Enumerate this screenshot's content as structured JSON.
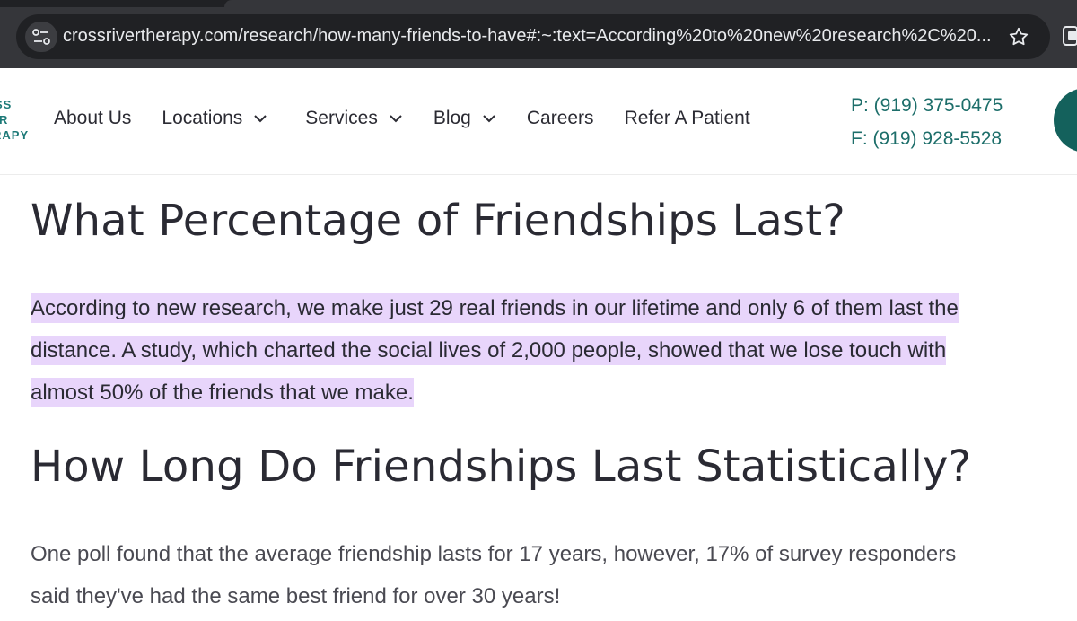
{
  "browser": {
    "url": "crossrivertherapy.com/research/how-many-friends-to-have#:~:text=According%20to%20new%20research%2C%20..."
  },
  "header": {
    "logo_lines": [
      "SS",
      "R",
      "RAPY"
    ],
    "nav": {
      "about": "About Us",
      "locations": "Locations",
      "services": "Services",
      "blog": "Blog",
      "careers": "Careers",
      "refer": "Refer A Patient"
    },
    "phone": "P: (919) 375-0475",
    "fax": "F: (919) 928-5528"
  },
  "article": {
    "heading1": "What Percentage of Friendships Last?",
    "paragraph1_lines": [
      "According to new research, we make just 29 real friends in our lifetime and only 6 of them last the",
      "distance. A study, which charted the social lives of 2,000 people, showed that we lose touch with",
      "almost 50% of the friends that we make."
    ],
    "heading2": "How Long Do Friendships Last Statistically?",
    "paragraph2_lines": [
      "One poll found that the average friendship lasts for 17 years, however, 17% of survey responders",
      "said they've had the same best friend for over 30 years!"
    ]
  },
  "colors": {
    "brand_teal": "#1d6e6a",
    "highlight": "#e8d5fb",
    "chrome_dark": "#35363a"
  }
}
